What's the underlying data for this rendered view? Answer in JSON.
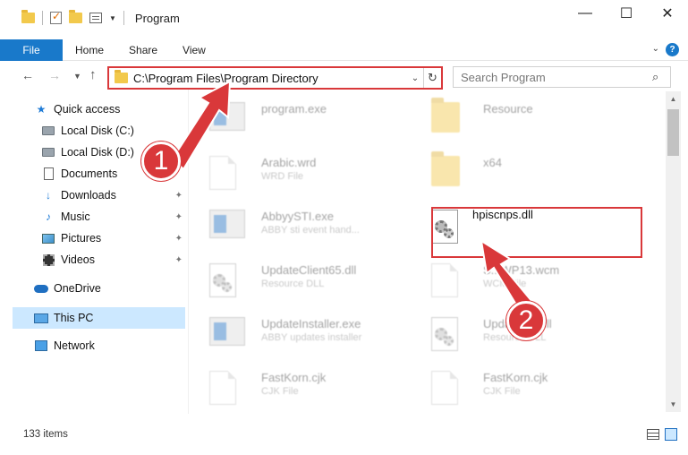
{
  "window": {
    "title": "Program",
    "controls": {
      "minimize": "—",
      "maximize": "☐",
      "close": "✕"
    }
  },
  "ribbon": {
    "file_tab": "File",
    "tabs": [
      "Home",
      "Share",
      "View"
    ]
  },
  "address_bar": {
    "path": "C:\\Program Files\\Program Directory",
    "search_placeholder": "Search Program"
  },
  "sidebar": {
    "items": [
      {
        "label": "Quick access",
        "icon": "star-icon"
      },
      {
        "label": "Local Disk (C:)",
        "icon": "drive-icon"
      },
      {
        "label": "Local Disk (D:)",
        "icon": "drive-icon"
      },
      {
        "label": "Documents",
        "icon": "documents-icon"
      },
      {
        "label": "Downloads",
        "icon": "download-icon"
      },
      {
        "label": "Music",
        "icon": "music-icon"
      },
      {
        "label": "Pictures",
        "icon": "pictures-icon"
      },
      {
        "label": "Videos",
        "icon": "videos-icon"
      },
      {
        "label": "OneDrive",
        "icon": "onedrive-icon"
      },
      {
        "label": "This PC",
        "icon": "pc-icon"
      },
      {
        "label": "Network",
        "icon": "network-icon"
      }
    ]
  },
  "files": [
    {
      "name": "program.exe",
      "type": ""
    },
    {
      "name": "Resource",
      "type": ""
    },
    {
      "name": "Arabic.wrd",
      "type": "WRD File"
    },
    {
      "name": "x64",
      "type": ""
    },
    {
      "name": "AbbyySTI.exe",
      "type": "ABBY sti event hand..."
    },
    {
      "name": "hpiscnps.dll",
      "type": ""
    },
    {
      "name": "UpdateClient65.dll",
      "type": "Resource DLL"
    },
    {
      "name": "S...WP13.wcm",
      "type": "WCM File"
    },
    {
      "name": "UpdateInstaller.exe",
      "type": "ABBY updates installer"
    },
    {
      "name": "Updat...21.dll",
      "type": "Resource DLL"
    },
    {
      "name": "FastKorn.cjk",
      "type": "CJK File"
    },
    {
      "name": "FastKorn.cjk",
      "type": "CJK File"
    }
  ],
  "annotations": {
    "step1": "1",
    "step2": "2"
  },
  "status": {
    "item_count": "133 items"
  },
  "colors": {
    "accent": "#1979ca",
    "highlight": "#d9383a",
    "selection": "#cce8ff"
  }
}
